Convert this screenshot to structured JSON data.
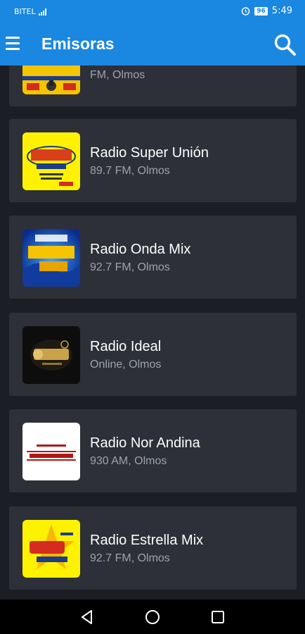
{
  "status": {
    "carrier": "BITEL",
    "network": "4G",
    "battery": "96",
    "time": "5:49"
  },
  "appbar": {
    "title": "Emisoras"
  },
  "stations": [
    {
      "name": "",
      "details": "FM, Olmos"
    },
    {
      "name": "Radio Super Unión",
      "details": "89.7 FM, Olmos"
    },
    {
      "name": "Radio Onda Mix",
      "details": "92.7 FM, Olmos"
    },
    {
      "name": "Radio Ideal",
      "details": "Online, Olmos"
    },
    {
      "name": "Radio Nor Andina",
      "details": "930 AM, Olmos"
    },
    {
      "name": "Radio Estrella Mix",
      "details": "92.7 FM, Olmos"
    }
  ],
  "colors": {
    "primary": "#1a87e0",
    "background": "#1b1e24",
    "card": "#2d3038"
  }
}
